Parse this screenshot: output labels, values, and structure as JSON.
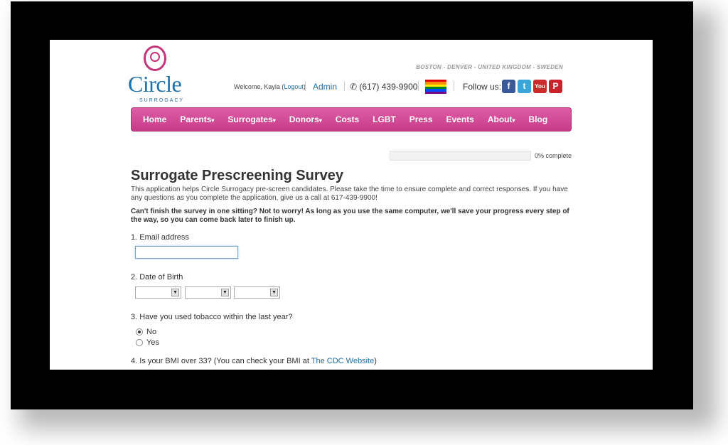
{
  "header": {
    "brand": "Circle",
    "brand_sub": "SURROGACY",
    "locations": "BOSTON - DENVER - UNITED KINGDOM - SWEDEN",
    "welcome_prefix": "Welcome, Kayla (",
    "logout": "Logout",
    "welcome_suffix": ")",
    "admin": "Admin",
    "phone": "(617) 439-9900",
    "follow": "Follow us:",
    "social": [
      {
        "icon": "facebook-icon",
        "glyph": "f",
        "color": "#3b5998"
      },
      {
        "icon": "twitter-icon",
        "glyph": "t",
        "color": "#3aa5d8"
      },
      {
        "icon": "youtube-icon",
        "glyph": "You",
        "color": "#cc2b2b"
      },
      {
        "icon": "pinterest-icon",
        "glyph": "P",
        "color": "#c8232c"
      }
    ]
  },
  "nav": [
    "Home",
    "Parents",
    "Surrogates",
    "Donors",
    "Costs",
    "LGBT",
    "Press",
    "Events",
    "About",
    "Blog"
  ],
  "nav_dropdown": [
    false,
    true,
    true,
    true,
    false,
    false,
    false,
    false,
    true,
    false
  ],
  "progress": {
    "percent": 0,
    "label": "0% complete"
  },
  "survey": {
    "title": "Surrogate Prescreening Survey",
    "intro": "This application helps Circle Surrogacy pre-screen candidates. Please take the time to ensure complete and correct responses. If you have any questions as you complete the application, give us a call at 617-439-9900!",
    "note": "Can't finish the survey in one sitting? Not to worry! As long as you use the same computer, we'll save your progress every step of the way, so you can come back later to finish up.",
    "q1": "1. Email address",
    "email_value": "",
    "q2": "2. Date of Birth",
    "q3": "3. Have you used tobacco within the last year?",
    "q3_options": [
      "No",
      "Yes"
    ],
    "q3_selected": "No",
    "q4_prefix": "4. Is your BMI over 33? (You can check your BMI at ",
    "q4_link": "The CDC Website",
    "q4_suffix": ")"
  },
  "colors": {
    "brand_pink": "#c93a89",
    "brand_blue": "#1e6fa8"
  }
}
